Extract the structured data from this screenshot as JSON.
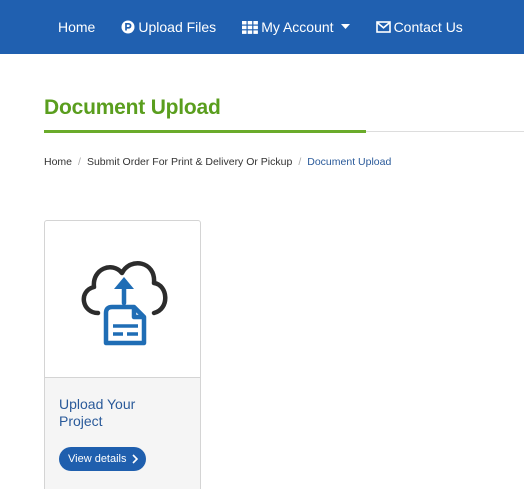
{
  "nav": {
    "items": [
      {
        "label": "Home",
        "icon": ""
      },
      {
        "label": "Upload Files",
        "icon": "upload-circle-icon"
      },
      {
        "label": "My Account",
        "icon": "grid-icon"
      },
      {
        "label": "Contact Us",
        "icon": "envelope-icon"
      }
    ]
  },
  "page": {
    "title": "Document Upload"
  },
  "breadcrumb": {
    "items": [
      "Home",
      "Submit Order For Print & Delivery Or Pickup",
      "Document Upload"
    ],
    "separator": "/"
  },
  "card": {
    "icon": "cloud-upload-document-icon",
    "title": "Upload Your Project",
    "button_label": "View details"
  },
  "colors": {
    "navbar": "#2060b0",
    "title_green": "#5a9e1e",
    "link_blue": "#2a5a9a",
    "button_blue": "#1f5fae"
  }
}
